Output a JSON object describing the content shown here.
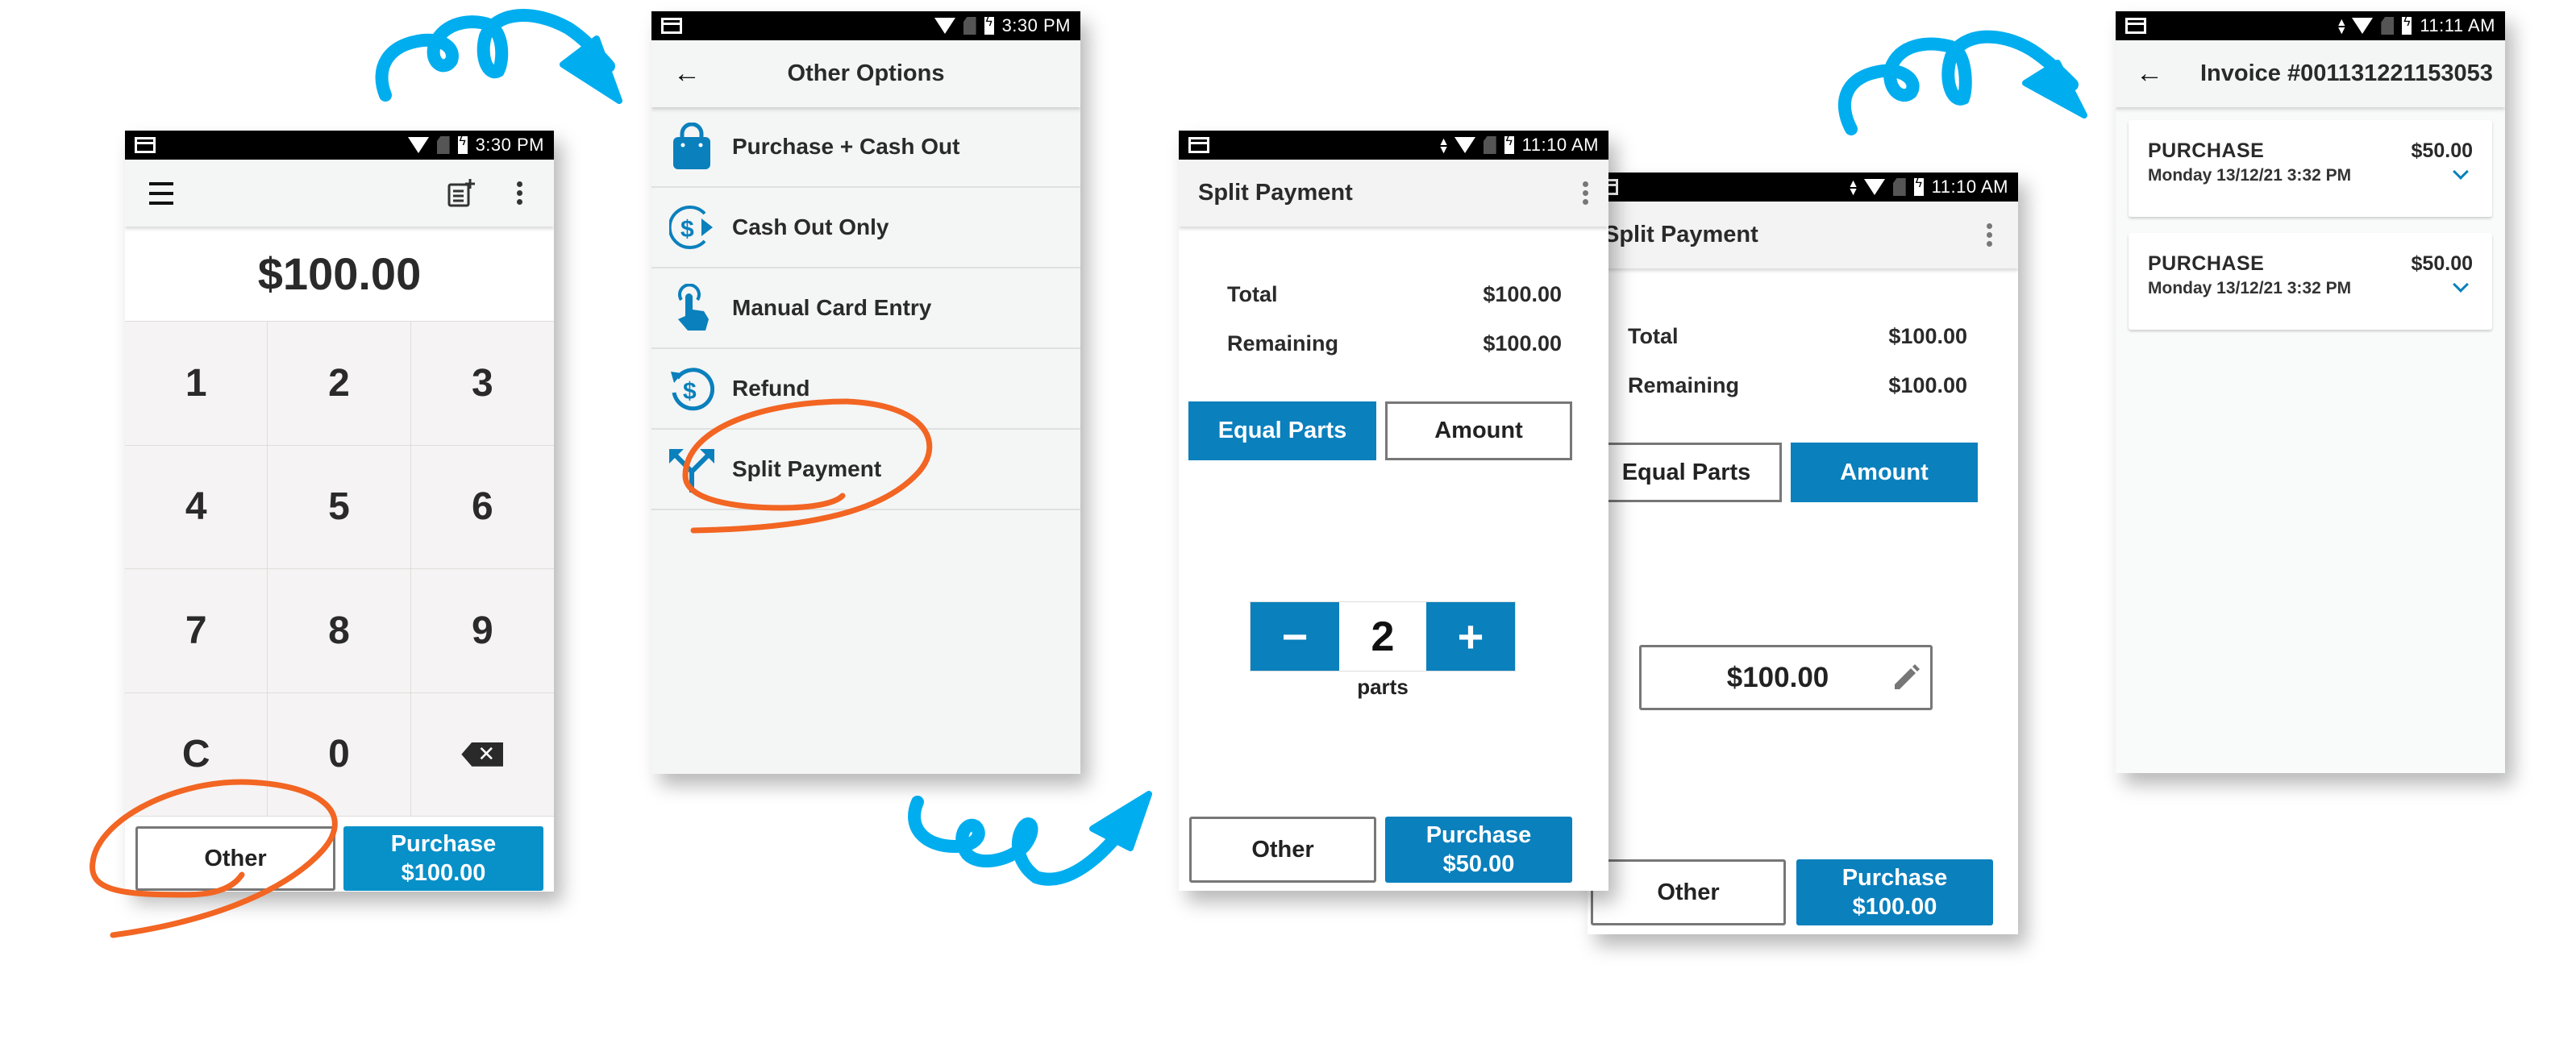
{
  "colors": {
    "brand_blue": "#0a80bd",
    "arrow_blue": "#00aeef",
    "annotation_orange": "#f26522"
  },
  "screens": {
    "keypad": {
      "status_time": "3:30 PM",
      "menu_icon": "hamburger-menu-icon",
      "add_note_icon": "note-add-icon",
      "more_icon": "more-vertical-icon",
      "amount": "$100.00",
      "keys": [
        "1",
        "2",
        "3",
        "4",
        "5",
        "6",
        "7",
        "8",
        "9",
        "C",
        "0"
      ],
      "backspace_icon": "backspace-icon",
      "other_label": "Other",
      "purchase_label": "Purchase",
      "purchase_amount": "$100.00"
    },
    "other_options": {
      "status_time": "3:30 PM",
      "title": "Other Options",
      "back_icon": "arrow-back-icon",
      "items": [
        {
          "label": "Purchase + Cash Out",
          "icon": "shopping-bag-icon"
        },
        {
          "label": "Cash Out Only",
          "icon": "cash-out-icon"
        },
        {
          "label": "Manual Card Entry",
          "icon": "touch-hand-icon"
        },
        {
          "label": "Refund",
          "icon": "refund-icon"
        },
        {
          "label": "Split Payment",
          "icon": "split-arrows-icon"
        }
      ]
    },
    "split_equal": {
      "status_time": "11:10 AM",
      "title": "Split Payment",
      "total_label": "Total",
      "total_value": "$100.00",
      "remaining_label": "Remaining",
      "remaining_value": "$100.00",
      "tab_equal": "Equal Parts",
      "tab_amount": "Amount",
      "active_tab": "Equal Parts",
      "minus_label": "−",
      "plus_label": "+",
      "parts_value": "2",
      "parts_label": "parts",
      "other_label": "Other",
      "purchase_label": "Purchase",
      "purchase_amount": "$50.00"
    },
    "split_amount": {
      "status_time": "11:10 AM",
      "title": "Split Payment",
      "total_label": "Total",
      "total_value": "$100.00",
      "remaining_label": "Remaining",
      "remaining_value": "$100.00",
      "tab_equal": "Equal Parts",
      "tab_amount": "Amount",
      "active_tab": "Amount",
      "amount_value": "$100.00",
      "edit_icon": "pencil-icon",
      "other_label": "Other",
      "purchase_label": "Purchase",
      "purchase_amount": "$100.00"
    },
    "invoice": {
      "status_time": "11:11 AM",
      "title": "Invoice #001131221153053",
      "back_icon": "arrow-back-icon",
      "transactions": [
        {
          "type": "PURCHASE",
          "amount": "$50.00",
          "date": "Monday 13/12/21 3:32 PM"
        },
        {
          "type": "PURCHASE",
          "amount": "$50.00",
          "date": "Monday 13/12/21 3:32 PM"
        }
      ]
    }
  }
}
